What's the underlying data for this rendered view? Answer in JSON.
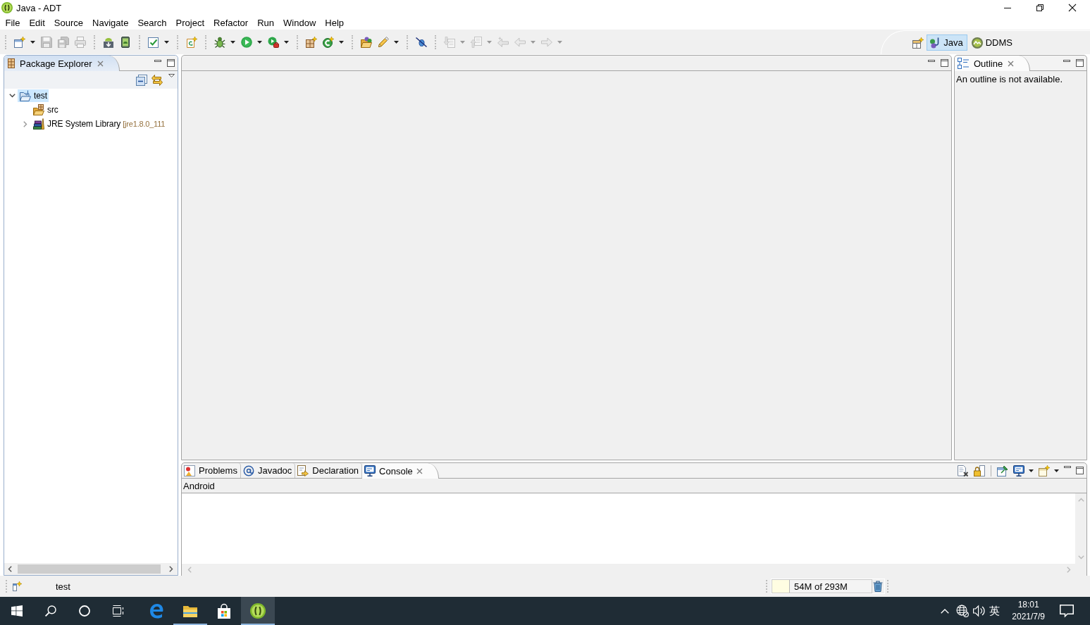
{
  "window": {
    "title": "Java - ADT"
  },
  "menu": [
    "File",
    "Edit",
    "Source",
    "Navigate",
    "Search",
    "Project",
    "Refactor",
    "Run",
    "Window",
    "Help"
  ],
  "toolbar": [
    [
      {
        "disabled": false,
        "menu": true
      },
      {
        "disabled": true,
        "menu": false
      },
      {
        "disabled": true,
        "menu": false
      },
      {
        "disabled": true,
        "menu": false
      }
    ],
    [
      {
        "disabled": false,
        "menu": false
      },
      {
        "disabled": false,
        "menu": false
      }
    ],
    [
      {
        "disabled": false,
        "menu": true
      }
    ],
    [
      {
        "disabled": false,
        "menu": false
      }
    ],
    [
      {
        "disabled": false,
        "menu": true
      },
      {
        "disabled": false,
        "menu": true
      },
      {
        "disabled": false,
        "menu": true
      }
    ],
    [
      {
        "disabled": false,
        "menu": false
      },
      {
        "disabled": false,
        "menu": true
      }
    ],
    [
      {
        "disabled": false,
        "menu": false
      },
      {
        "disabled": false,
        "menu": true
      }
    ],
    [
      {
        "disabled": false,
        "menu": false
      }
    ],
    [
      {
        "disabled": true,
        "menu": true
      },
      {
        "disabled": true,
        "menu": true
      },
      {
        "disabled": true,
        "menu": false
      },
      {
        "disabled": true,
        "menu": true
      },
      {
        "disabled": true,
        "menu": true
      }
    ]
  ],
  "perspectives": [
    {
      "label": "Java",
      "selected": true
    },
    {
      "label": "DDMS",
      "selected": false
    }
  ],
  "package_explorer": {
    "active": true,
    "tabs": [
      {
        "label": "Package Explorer",
        "selected": true
      }
    ],
    "tree": [
      {
        "kind": "project",
        "label": "test",
        "selected": true,
        "expanded": true,
        "children": [
          {
            "kind": "source_folder",
            "label": "src",
            "selected": false
          },
          {
            "kind": "library",
            "label": "JRE System Library",
            "decoration": "[jre1.8.0_111",
            "selected": false,
            "expanded": false
          }
        ]
      }
    ]
  },
  "outline": {
    "active": false,
    "tabs": [
      {
        "label": "Outline",
        "selected": true
      }
    ],
    "message": "An outline is not available."
  },
  "console": {
    "active": false,
    "tabs": [
      {
        "label": "Problems",
        "selected": false
      },
      {
        "label": "Javadoc",
        "selected": false
      },
      {
        "label": "Declaration",
        "selected": false
      },
      {
        "label": "Console",
        "selected": true
      }
    ],
    "name": "Android"
  },
  "status_bar": {
    "selection": "test",
    "memory": {
      "text": "54M of 293M",
      "level": 0.18
    }
  },
  "taskbar": {
    "apps": [
      {
        "running": false,
        "selected": false
      },
      {
        "running": true,
        "selected": false
      },
      {
        "running": false,
        "selected": false
      },
      {
        "running": true,
        "selected": true
      }
    ],
    "ime": "英",
    "time": "18:01",
    "date": "2021/7/9"
  }
}
